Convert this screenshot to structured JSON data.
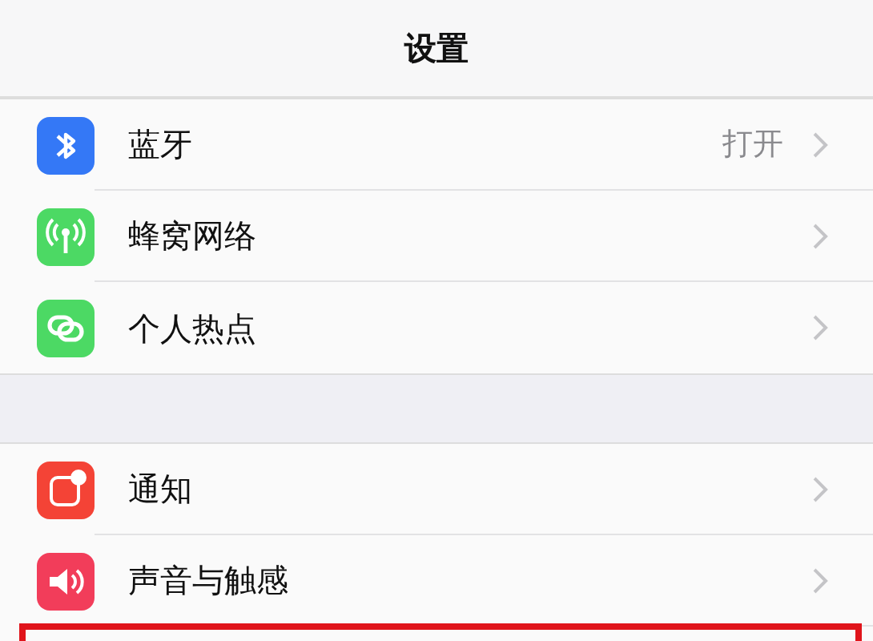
{
  "title": "设置",
  "groups": [
    {
      "rows": [
        {
          "kind": "bluetooth",
          "color": "#3478f6",
          "label": "蓝牙",
          "value": "打开",
          "highlighted": false
        },
        {
          "kind": "cellular",
          "color": "#4cd964",
          "label": "蜂窝网络",
          "highlighted": false
        },
        {
          "kind": "hotspot",
          "color": "#4cd964",
          "label": "个人热点",
          "highlighted": false
        }
      ]
    },
    {
      "rows": [
        {
          "kind": "notifications",
          "color": "#f44336",
          "label": "通知",
          "highlighted": false
        },
        {
          "kind": "sounds",
          "color": "#f23d5a",
          "label": "声音与触感",
          "highlighted": false
        },
        {
          "kind": "blank",
          "highlighted": true
        }
      ]
    }
  ]
}
